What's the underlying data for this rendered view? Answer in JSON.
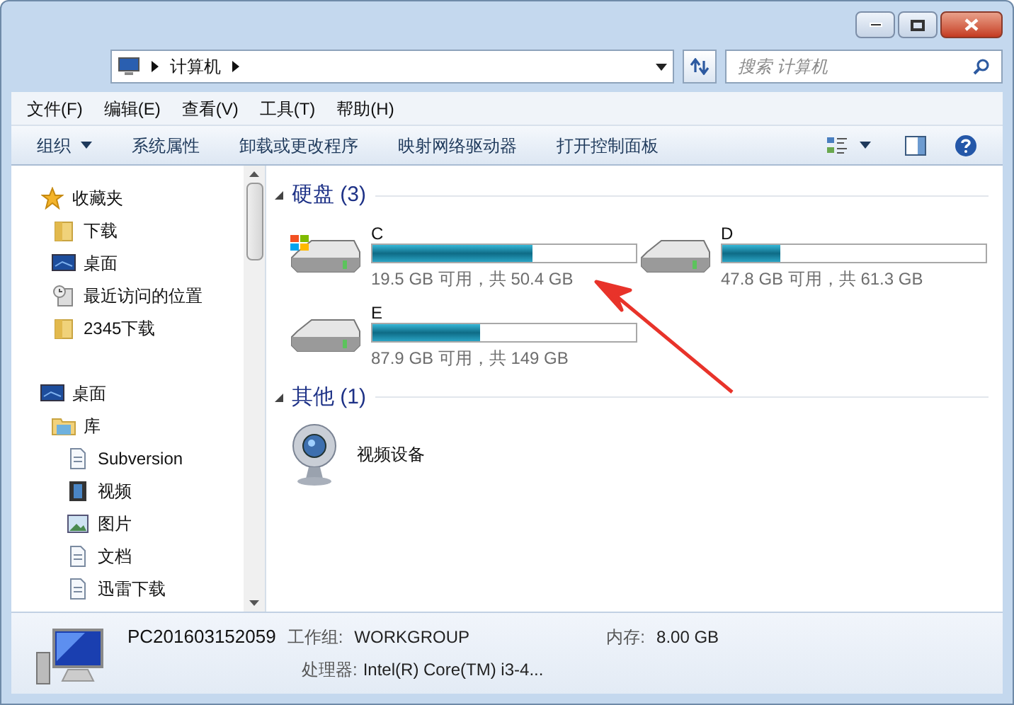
{
  "address_bar": {
    "path": [
      "计算机"
    ]
  },
  "search": {
    "placeholder": "搜索 计算机"
  },
  "menu_bar": [
    "文件(F)",
    "编辑(E)",
    "查看(V)",
    "工具(T)",
    "帮助(H)"
  ],
  "toolbar": [
    {
      "label": "组织",
      "dropdown": true
    },
    {
      "label": "系统属性",
      "dropdown": false
    },
    {
      "label": "卸载或更改程序",
      "dropdown": false
    },
    {
      "label": "映射网络驱动器",
      "dropdown": false
    },
    {
      "label": "打开控制面板",
      "dropdown": false
    }
  ],
  "sidebar": {
    "items": [
      {
        "label": "收藏夹",
        "kind": "star",
        "children": [
          {
            "label": "下载",
            "kind": "folder"
          },
          {
            "label": "桌面",
            "kind": "desktop"
          },
          {
            "label": "最近访问的位置",
            "kind": "recent"
          },
          {
            "label": "2345下载",
            "kind": "folder"
          }
        ]
      },
      {
        "label": "桌面",
        "kind": "desktop",
        "children": [
          {
            "label": "库",
            "kind": "library",
            "children": [
              {
                "label": "Subversion",
                "kind": "doc"
              },
              {
                "label": "视频",
                "kind": "video"
              },
              {
                "label": "图片",
                "kind": "picture"
              },
              {
                "label": "文档",
                "kind": "doc"
              },
              {
                "label": "迅雷下载",
                "kind": "doc"
              }
            ]
          }
        ]
      }
    ]
  },
  "groups": [
    {
      "title": "硬盘 (3)",
      "items": [
        {
          "kind": "drive",
          "system": true,
          "name": "C",
          "level": 0.61,
          "reading": "19.5 GB 可用，共 50.4 GB"
        },
        {
          "kind": "drive",
          "system": false,
          "name": "D",
          "level": 0.22,
          "reading": "47.8 GB 可用，共 61.3 GB"
        },
        {
          "kind": "drive",
          "system": false,
          "name": "E",
          "level": 0.41,
          "reading": "87.9 GB 可用，共 149 GB"
        }
      ]
    },
    {
      "title": "其他 (1)",
      "items": [
        {
          "kind": "device",
          "name": "视频设备"
        }
      ]
    }
  ],
  "details": {
    "computer_name": "PC201603152059",
    "fields": [
      {
        "label": "工作组:",
        "value": "WORKGROUP"
      },
      {
        "label": "内存:",
        "value": "8.00 GB"
      },
      {
        "label": "处理器:",
        "value": "Intel(R) Core(TM) i3-4..."
      }
    ]
  }
}
